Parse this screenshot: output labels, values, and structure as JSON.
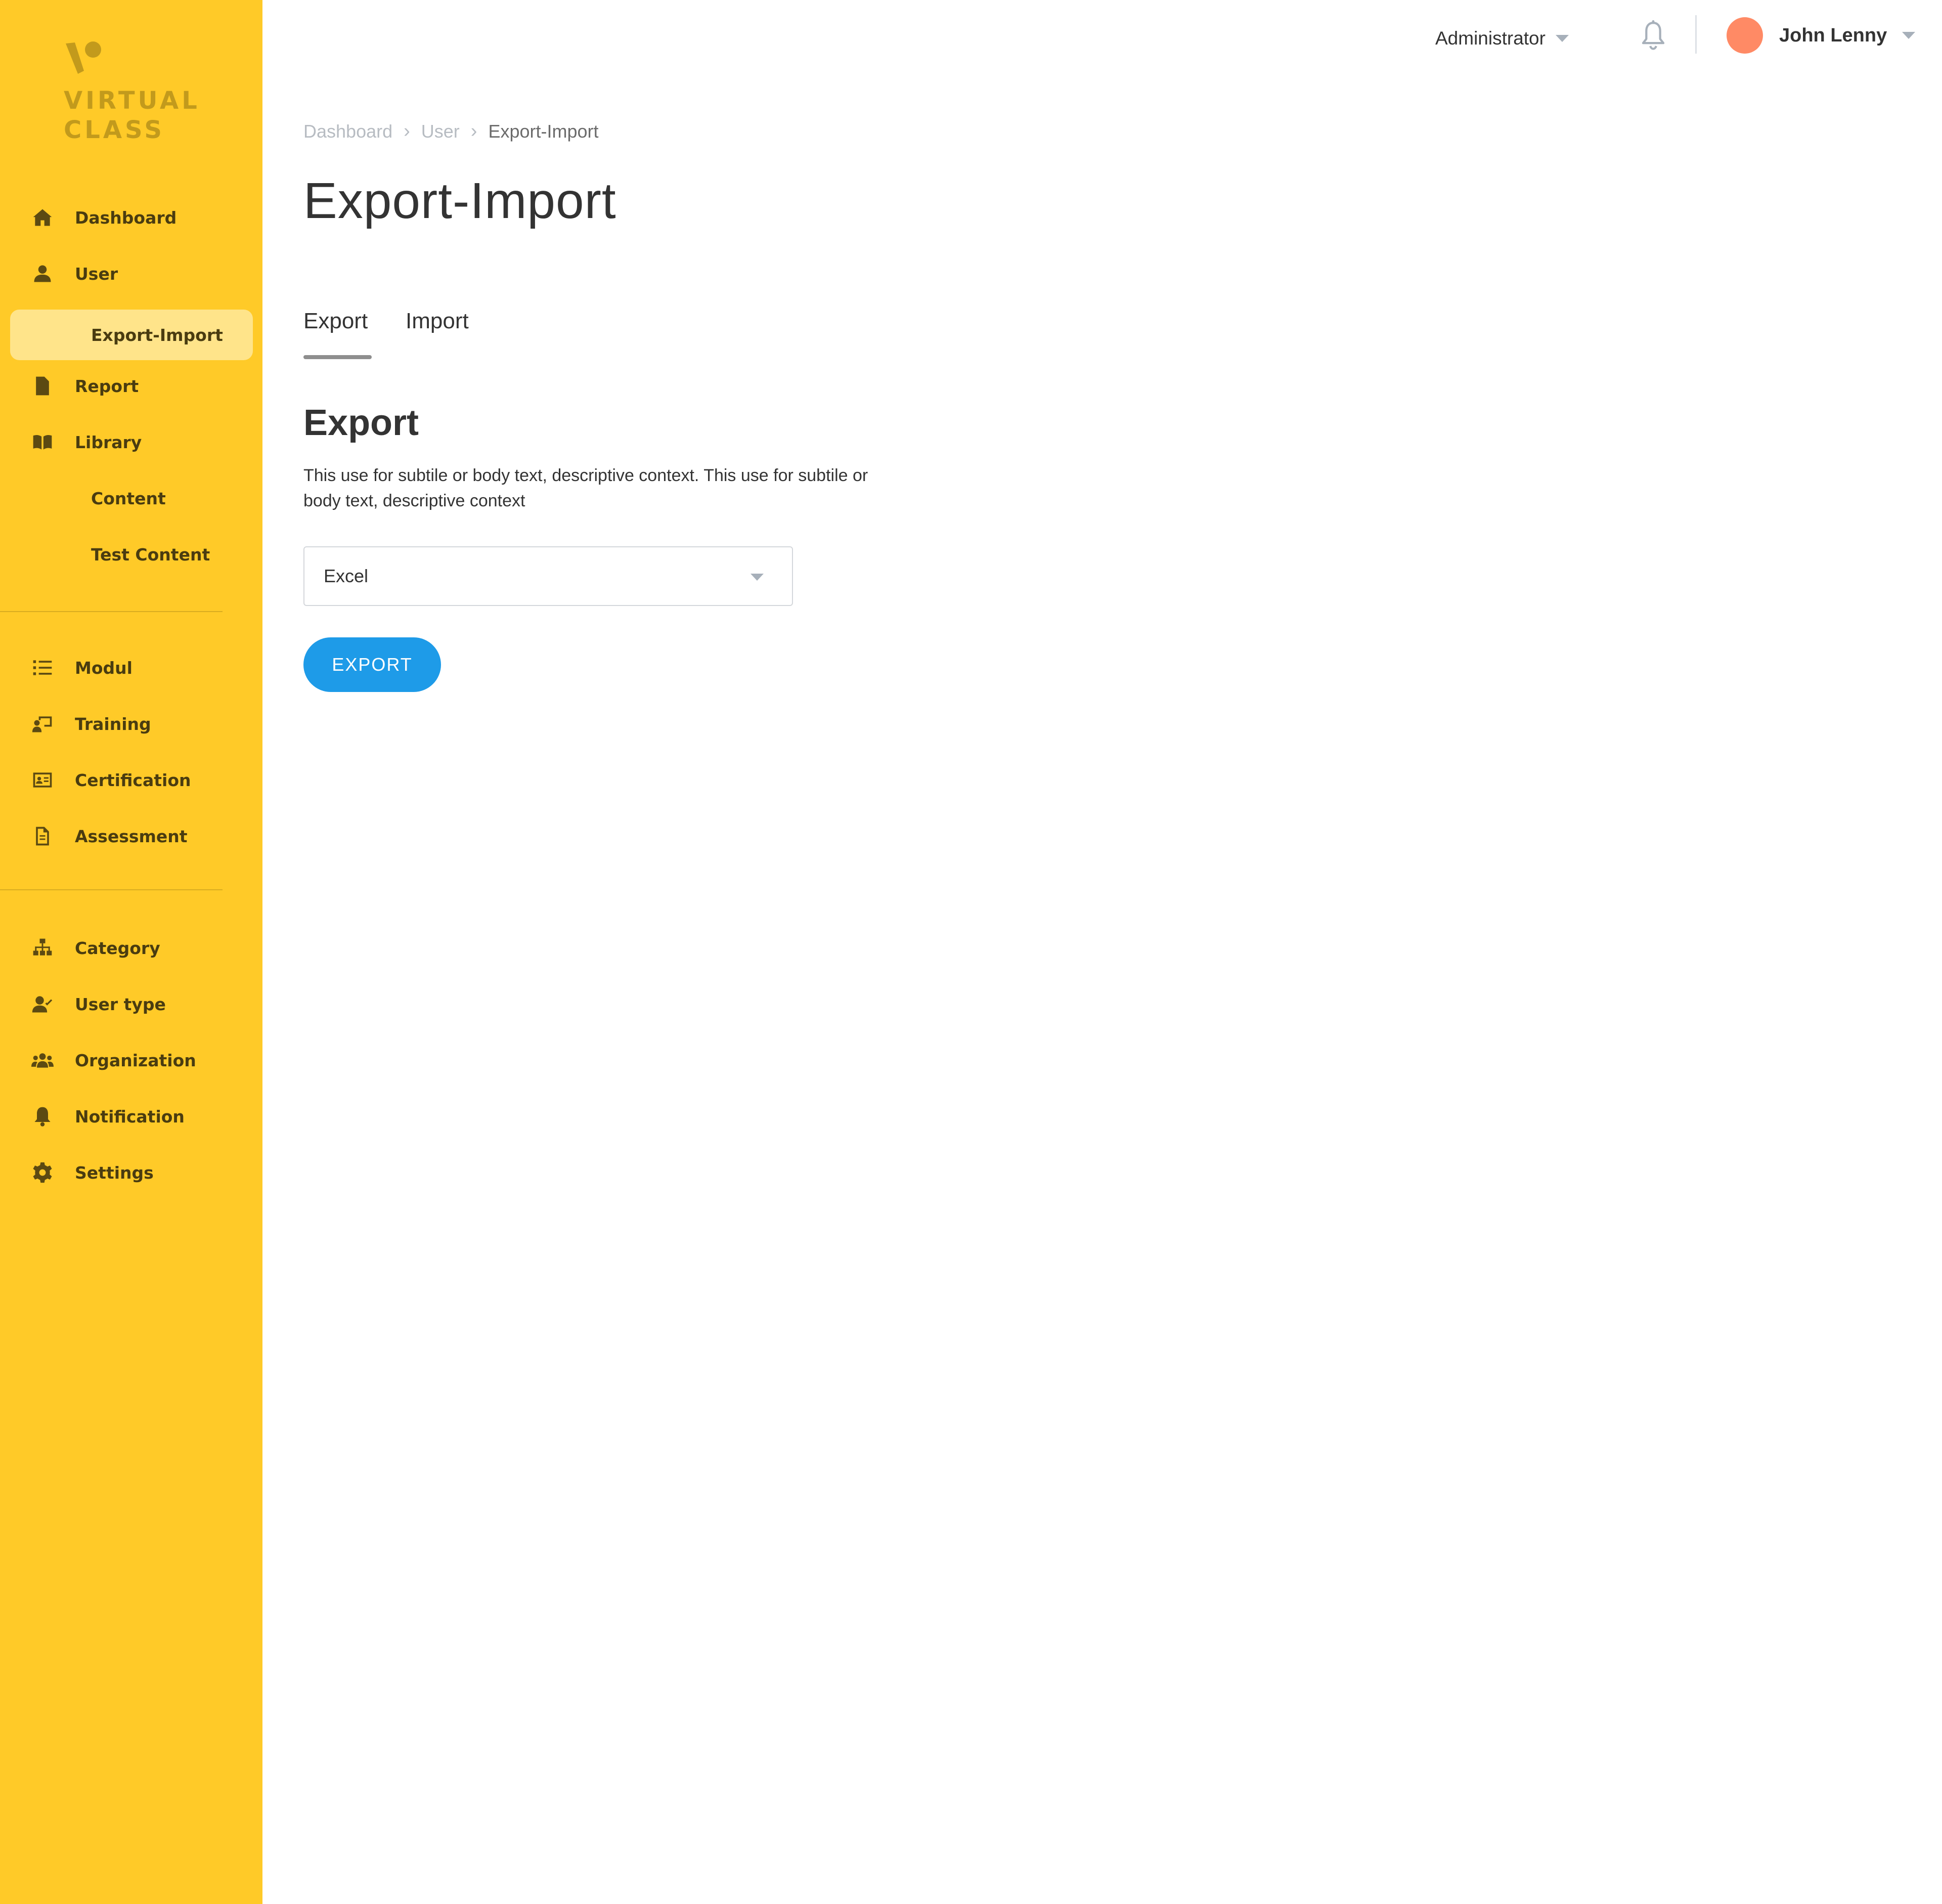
{
  "brand": {
    "line1": "VIRTUAL",
    "line2": "CLASS",
    "color": "#FFCA28"
  },
  "sidebar": {
    "items": [
      {
        "label": "Dashboard",
        "icon": "home-icon"
      },
      {
        "label": "User",
        "icon": "user-icon"
      },
      {
        "label": "Export-Import",
        "icon": "",
        "active": true
      },
      {
        "label": "Report",
        "icon": "report-icon"
      },
      {
        "label": "Library",
        "icon": "book-icon"
      },
      {
        "label": "Content",
        "icon": ""
      },
      {
        "label": "Test Content",
        "icon": ""
      },
      {
        "label": "Modul",
        "icon": "list-icon"
      },
      {
        "label": "Training",
        "icon": "training-icon"
      },
      {
        "label": "Certification",
        "icon": "certificate-icon"
      },
      {
        "label": "Assessment",
        "icon": "assessment-icon"
      },
      {
        "label": "Category",
        "icon": "category-icon"
      },
      {
        "label": "User type",
        "icon": "user-check-icon"
      },
      {
        "label": "Organization",
        "icon": "organization-icon"
      },
      {
        "label": "Notification",
        "icon": "bell-icon"
      },
      {
        "label": "Settings",
        "icon": "gear-icon"
      }
    ]
  },
  "topbar": {
    "role": "Administrator",
    "user_name": "John Lenny",
    "avatar_color": "#FF8A65"
  },
  "breadcrumb": [
    "Dashboard",
    "User",
    "Export-Import"
  ],
  "page": {
    "title": "Export-Import",
    "tabs": [
      {
        "label": "Export",
        "active": true
      },
      {
        "label": "Import",
        "active": false
      }
    ],
    "section_title": "Export",
    "section_desc": "This use for subtile or body text, descriptive context. This use for subtile or body text, descriptive context",
    "format_select": {
      "value": "Excel"
    },
    "export_button": "EXPORT",
    "button_color": "#1E9BE8"
  }
}
